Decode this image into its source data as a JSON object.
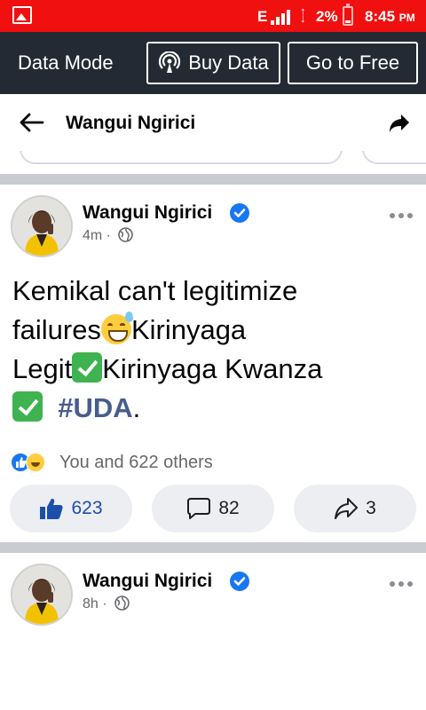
{
  "status_bar": {
    "network_label": "E",
    "battery_percent": "2%",
    "time": "8:45",
    "ampm": "PM",
    "colors": {
      "background": "#f01010"
    }
  },
  "data_bar": {
    "mode_label": "Data Mode",
    "buy_data_label": "Buy Data",
    "go_to_free_label": "Go to Free"
  },
  "header": {
    "title": "Wangui Ngirici",
    "back_icon": "arrow-left-icon",
    "share_icon": "share-arrow-icon"
  },
  "posts": [
    {
      "author": "Wangui Ngirici",
      "verified": true,
      "time": "4m",
      "audience_icon": "globe-icon",
      "text_parts": {
        "line1": "Kemikal can't legitimize",
        "line2a": "failures",
        "line2b": "Kirinyaga",
        "line3a": "Legit",
        "line3b": "Kirinyaga Kwanza",
        "hashtag": "#UDA",
        "end": "."
      },
      "reactions_text": "You and 622 others",
      "like_count": "623",
      "comment_count": "82",
      "share_count": "3"
    },
    {
      "author": "Wangui Ngirici",
      "verified": true,
      "time": "8h",
      "audience_icon": "globe-icon"
    }
  ],
  "colors": {
    "facebook_blue": "#1877f2",
    "hashtag": "#475d8e",
    "data_bar_bg": "#232a34"
  }
}
